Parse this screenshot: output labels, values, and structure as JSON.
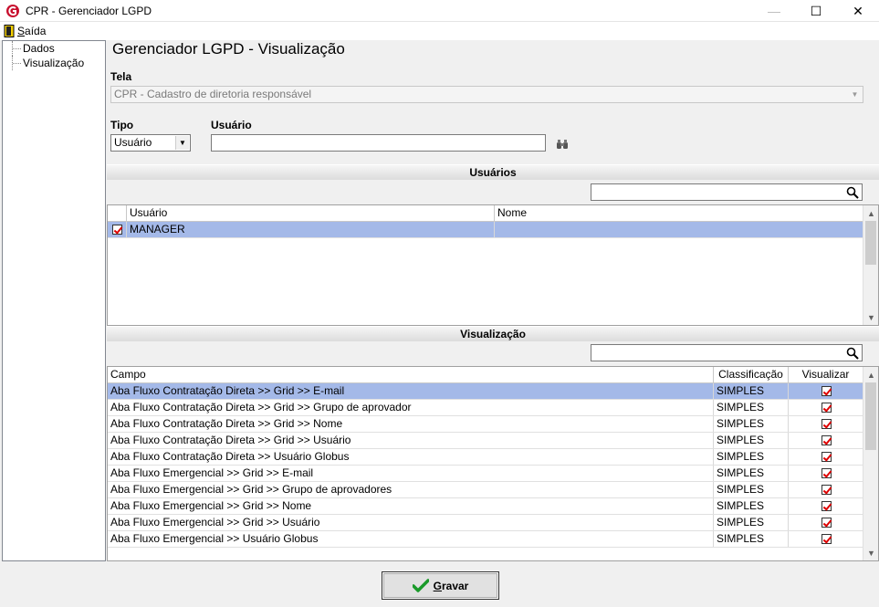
{
  "window": {
    "title": "CPR - Gerenciador LGPD",
    "minimize": "—",
    "maximize": "☐",
    "close": "✕"
  },
  "menu": {
    "saida_prefix": "S",
    "saida_rest": "aída"
  },
  "tree": {
    "items": [
      "Dados",
      "Visualização"
    ]
  },
  "page_title": "Gerenciador LGPD - Visualização",
  "tela": {
    "label": "Tela",
    "value": "CPR - Cadastro de diretoria responsável"
  },
  "tipo": {
    "label": "Tipo",
    "value": "Usuário"
  },
  "usuario": {
    "label": "Usuário",
    "value": ""
  },
  "usuarios_section": {
    "title": "Usuários",
    "search_value": "",
    "columns": [
      "Usuário",
      "Nome"
    ],
    "rows": [
      {
        "checked": true,
        "usuario": "MANAGER",
        "nome": ""
      }
    ]
  },
  "visualizacao_section": {
    "title": "Visualização",
    "search_value": "",
    "columns": [
      "Campo",
      "Classificação",
      "Visualizar"
    ],
    "rows": [
      {
        "campo": "Aba Fluxo Contratação Direta >> Grid >> E-mail",
        "classificacao": "SIMPLES",
        "visualizar": true
      },
      {
        "campo": "Aba Fluxo Contratação Direta >> Grid >> Grupo de aprovador",
        "classificacao": "SIMPLES",
        "visualizar": true
      },
      {
        "campo": "Aba Fluxo Contratação Direta >> Grid >> Nome",
        "classificacao": "SIMPLES",
        "visualizar": true
      },
      {
        "campo": "Aba Fluxo Contratação Direta >> Grid >> Usuário",
        "classificacao": "SIMPLES",
        "visualizar": true
      },
      {
        "campo": "Aba Fluxo Contratação Direta >> Usuário Globus",
        "classificacao": "SIMPLES",
        "visualizar": true
      },
      {
        "campo": "Aba Fluxo Emergencial >> Grid >> E-mail",
        "classificacao": "SIMPLES",
        "visualizar": true
      },
      {
        "campo": "Aba Fluxo Emergencial >> Grid >> Grupo de aprovadores",
        "classificacao": "SIMPLES",
        "visualizar": true
      },
      {
        "campo": "Aba Fluxo Emergencial >> Grid >> Nome",
        "classificacao": "SIMPLES",
        "visualizar": true
      },
      {
        "campo": "Aba Fluxo Emergencial >> Grid >> Usuário",
        "classificacao": "SIMPLES",
        "visualizar": true
      },
      {
        "campo": "Aba Fluxo Emergencial >> Usuário Globus",
        "classificacao": "SIMPLES",
        "visualizar": true
      }
    ]
  },
  "gravar_button": {
    "prefix": "G",
    "rest": "ravar"
  },
  "colors": {
    "selected_row": "#a4b9e8",
    "check_red": "#d00000",
    "check_green": "#1a9a2a"
  }
}
